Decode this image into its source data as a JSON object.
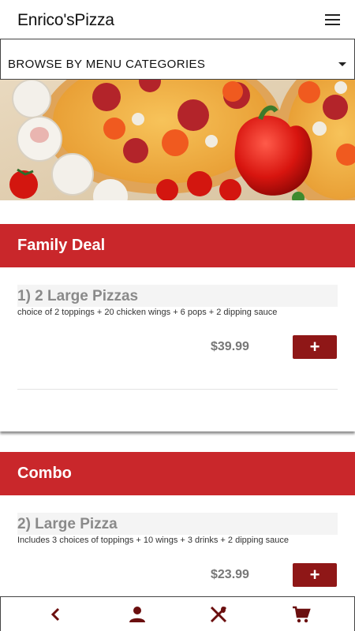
{
  "app": {
    "title": "Enrico'sPizza"
  },
  "header": {
    "menu_icon": "hamburger-menu-icon"
  },
  "category_select": {
    "selected": "BROWSE BY MENU CATEGORIES",
    "caret_icon": "dropdown-caret-icon"
  },
  "hero": {
    "image": "pizza-banner-photo"
  },
  "sections": [
    {
      "title": "Family Deal",
      "items": [
        {
          "name": "1)  2 Large Pizzas",
          "description": "choice of 2 toppings + 20 chicken wings + 6 pops + 2 dipping sauce",
          "price": "$39.99",
          "add_label": "+"
        }
      ]
    },
    {
      "title": "Combo",
      "items": [
        {
          "name": "2)  Large Pizza",
          "description": "Includes 3 choices of toppings + 10 wings + 3 drinks + 2 dipping sauce",
          "price": "$23.99",
          "add_label": "+"
        }
      ]
    }
  ],
  "bottom_nav": {
    "items": [
      {
        "icon": "back-chevron-icon"
      },
      {
        "icon": "account-icon"
      },
      {
        "icon": "restaurant-menu-icon"
      },
      {
        "icon": "cart-icon"
      }
    ]
  },
  "colors": {
    "brand_red": "#c9272b",
    "button_dark_red": "#8f1717",
    "price_grey": "#777777",
    "nav_icon": "#6b0f0f"
  }
}
